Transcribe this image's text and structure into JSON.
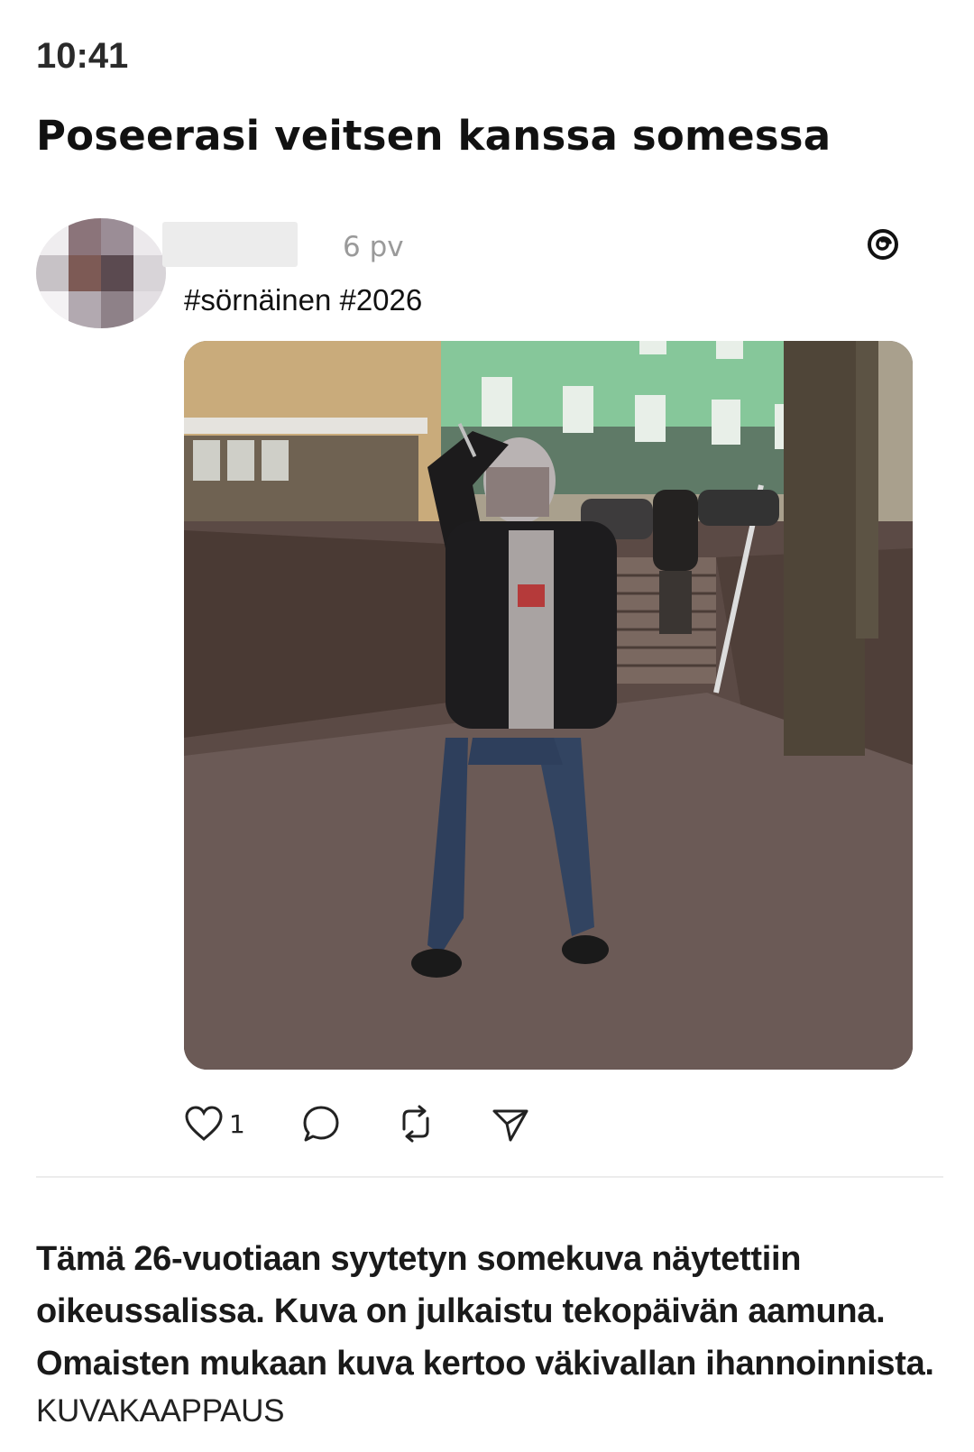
{
  "status_bar": {
    "time": "10:41"
  },
  "article": {
    "headline": "Poseerasi veitsen kanssa somessa"
  },
  "embedded_post": {
    "platform_icon": "threads-icon",
    "age": "6 pv",
    "text": "#sörnäinen #2026",
    "image_description_icon": "photo",
    "actions": {
      "like_icon": "heart-icon",
      "like_count": "1",
      "comment_icon": "comment-icon",
      "repost_icon": "repost-icon",
      "share_icon": "share-icon"
    }
  },
  "caption": {
    "text": "Tämä 26-vuotiaan syytetyn somekuva näytettiin oikeussalissa. Kuva on julkaistu tekopäivän aamuna. Omaisten mukaan kuva kertoo väkivallan ihannoinnista.",
    "credit": "KUVAKAAPPAUS"
  },
  "colors": {
    "background": "#ffffff",
    "text": "#111111",
    "muted": "#9a9a9a",
    "divider": "#ececec"
  }
}
